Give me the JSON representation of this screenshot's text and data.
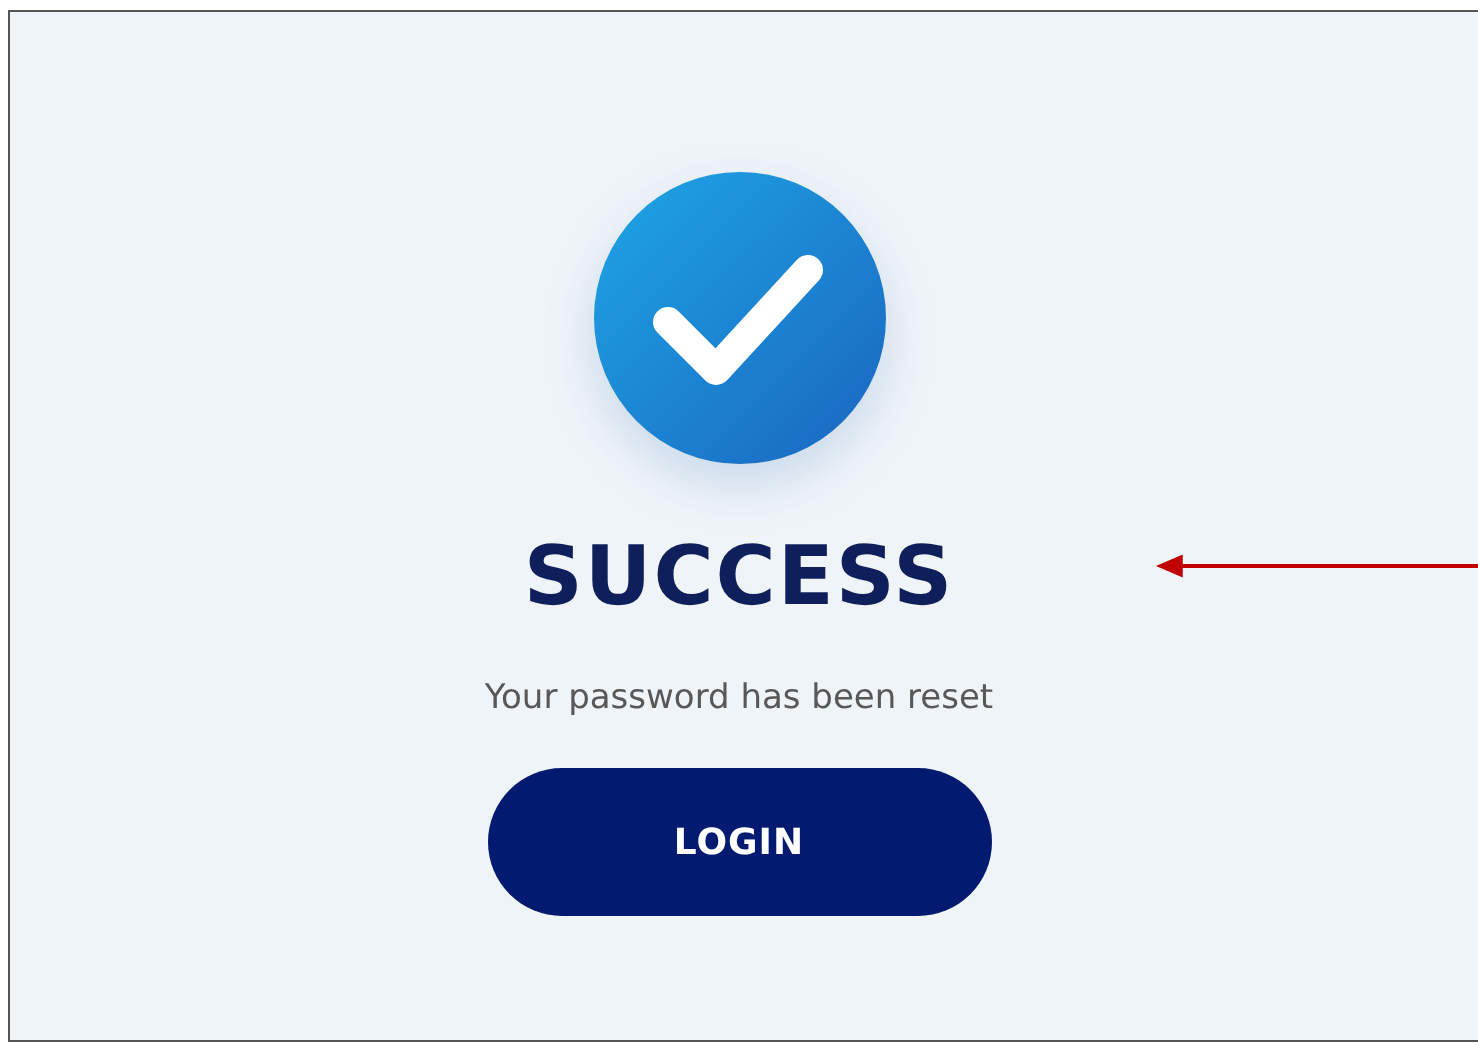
{
  "status": {
    "kind": "success",
    "title": "SUCCESS",
    "message": "Your password has been reset"
  },
  "button": {
    "label": "LOGIN"
  },
  "annotation": {
    "kind": "arrow"
  }
}
